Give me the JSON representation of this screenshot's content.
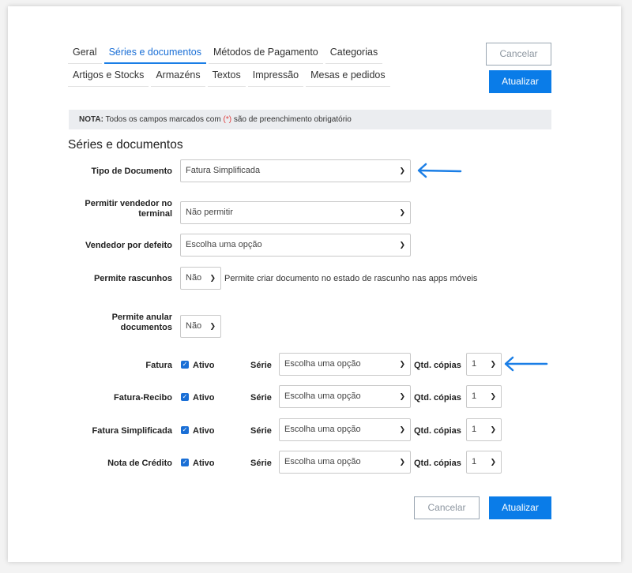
{
  "tabs": {
    "row1": [
      "Geral",
      "Séries e documentos",
      "Métodos de Pagamento",
      "Categorias"
    ],
    "row2": [
      "Artigos e Stocks",
      "Armazéns",
      "Textos",
      "Impressão",
      "Mesas e pedidos"
    ],
    "active": "Séries e documentos"
  },
  "actions": {
    "cancel": "Cancelar",
    "update": "Atualizar"
  },
  "note": {
    "prefix": "NOTA:",
    "before": " Todos os campos marcados com ",
    "marker": "(*)",
    "after": " são de preenchimento obrigatório"
  },
  "section_title": "Séries e documentos",
  "fields": {
    "tipo_documento": {
      "label": "Tipo de Documento",
      "value": "Fatura Simplificada"
    },
    "permitir_vendedor": {
      "label": "Permitir vendedor no terminal",
      "value": "Não permitir"
    },
    "vendedor_defeito": {
      "label": "Vendedor por defeito",
      "value": "Escolha uma opção"
    },
    "permite_rascunhos": {
      "label": "Permite rascunhos",
      "value": "Não",
      "hint": "Permite criar documento no estado de rascunho nas apps móveis"
    },
    "permite_anular": {
      "label": "Permite anular documentos",
      "value": "Não"
    }
  },
  "documents": {
    "active_label": "Ativo",
    "serie_label": "Série",
    "copies_label": "Qtd. cópias",
    "rows": [
      {
        "name": "Fatura",
        "active": true,
        "serie": "Escolha uma opção",
        "copies": "1"
      },
      {
        "name": "Fatura-Recibo",
        "active": true,
        "serie": "Escolha uma opção",
        "copies": "1"
      },
      {
        "name": "Fatura Simplificada",
        "active": true,
        "serie": "Escolha uma opção",
        "copies": "1"
      },
      {
        "name": "Nota de Crédito",
        "active": true,
        "serie": "Escolha uma opção",
        "copies": "1"
      }
    ]
  },
  "icons": {
    "chevron": "chevron-down-icon",
    "check": "checkbox-checked-icon",
    "arrow": "arrow-left-icon"
  },
  "colors": {
    "accent": "#0a7ce8",
    "annotation_arrow": "#1a7ee6",
    "required_marker": "#e03b3b"
  }
}
